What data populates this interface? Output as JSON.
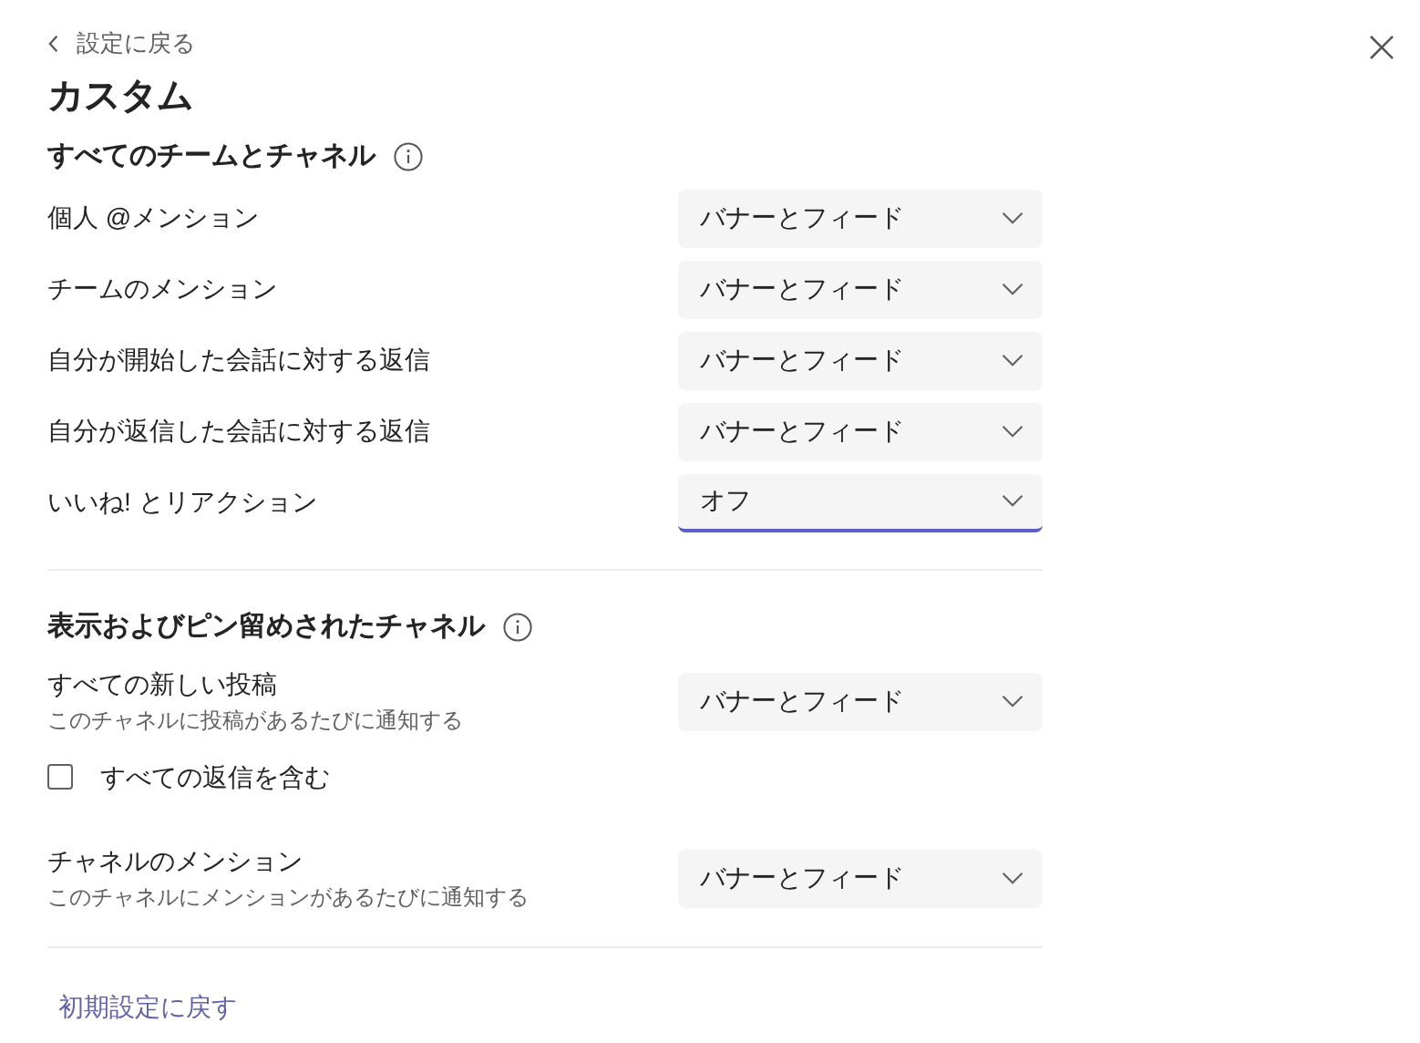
{
  "back_link": {
    "label": "設定に戻る"
  },
  "title": "カスタム",
  "sections": [
    {
      "heading": "すべてのチームとチャネル",
      "rows": [
        {
          "kind": "dropdown",
          "label": "個人 @メンション",
          "value": "バナーとフィード",
          "focused": false
        },
        {
          "kind": "dropdown",
          "label": "チームのメンション",
          "value": "バナーとフィード",
          "focused": false
        },
        {
          "kind": "dropdown",
          "label": "自分が開始した会話に対する返信",
          "value": "バナーとフィード",
          "focused": false
        },
        {
          "kind": "dropdown",
          "label": "自分が返信した会話に対する返信",
          "value": "バナーとフィード",
          "focused": false
        },
        {
          "kind": "dropdown",
          "label": "いいね! とリアクション",
          "value": "オフ",
          "focused": true
        }
      ]
    },
    {
      "heading": "表示およびピン留めされたチャネル",
      "rows": [
        {
          "kind": "dropdown",
          "label": "すべての新しい投稿",
          "description": "このチャネルに投稿があるたびに通知する",
          "value": "バナーとフィード",
          "focused": false
        },
        {
          "kind": "checkbox",
          "label": "すべての返信を含む",
          "checked": false
        },
        {
          "kind": "dropdown",
          "label": "チャネルのメンション",
          "description": "このチャネルにメンションがあるたびに通知する",
          "value": "バナーとフィード",
          "focused": false
        }
      ]
    }
  ],
  "reset_link": "初期設定に戻す"
}
